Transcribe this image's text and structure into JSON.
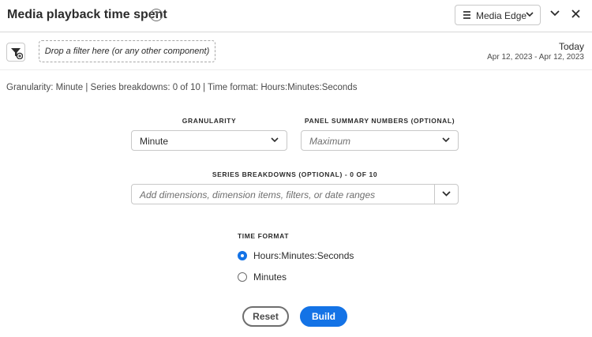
{
  "header": {
    "title": "Media playback time spent",
    "help_glyph": "?",
    "dataview_label": "Media Edge"
  },
  "filter_bar": {
    "dropzone_text": "Drop a filter here (or any other component)",
    "date_label": "Today",
    "date_range": "Apr 12, 2023 - Apr 12, 2023"
  },
  "summary": "Granularity: Minute | Series breakdowns: 0 of 10 | Time format: Hours:Minutes:Seconds",
  "form": {
    "granularity": {
      "label": "GRANULARITY",
      "value": "Minute"
    },
    "panel_summary": {
      "label": "PANEL SUMMARY NUMBERS (OPTIONAL)",
      "placeholder": "Maximum"
    },
    "series_breakdowns": {
      "label": "SERIES BREAKDOWNS (OPTIONAL) - 0 OF 10",
      "placeholder": "Add dimensions, dimension items, filters, or date ranges"
    },
    "time_format": {
      "label": "TIME FORMAT",
      "options": [
        {
          "label": "Hours:Minutes:Seconds",
          "selected": true
        },
        {
          "label": "Minutes",
          "selected": false
        }
      ]
    }
  },
  "actions": {
    "reset_label": "Reset",
    "build_label": "Build"
  },
  "colors": {
    "accent": "#1473e6",
    "text": "#2c2c2c",
    "border": "#c8c8c8"
  }
}
